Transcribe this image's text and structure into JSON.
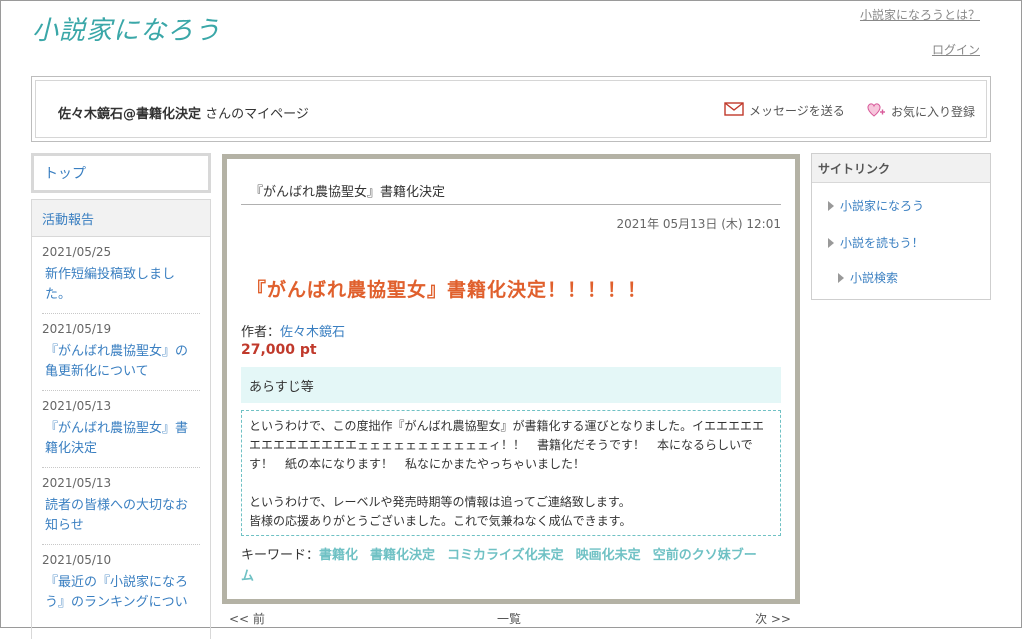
{
  "header": {
    "logo": "小説家になろう",
    "about_link": "小説家になろうとは？",
    "login_link": "ログイン"
  },
  "mypage": {
    "user_name": "佐々木鏡石@書籍化決定",
    "suffix": "さんのマイページ",
    "send_message": "メッセージを送る",
    "favorite": "お気に入り登録"
  },
  "left_sidebar": {
    "top_label": "トップ",
    "report_heading": "活動報告",
    "reports": [
      {
        "date": "2021/05/25",
        "title": "新作短編投稿致しました。"
      },
      {
        "date": "2021/05/19",
        "title": "『がんばれ農協聖女』の亀更新化について"
      },
      {
        "date": "2021/05/13",
        "title": "『がんばれ農協聖女』書籍化決定"
      },
      {
        "date": "2021/05/13",
        "title": "読者の皆様への大切なお知らせ"
      },
      {
        "date": "2021/05/10",
        "title": "『最近の『小説家になろう』のランキングについ"
      }
    ]
  },
  "entry": {
    "title": "『がんばれ農協聖女』書籍化決定",
    "date": "2021年 05月13日 (木) 12:01",
    "headline": "『がんばれ農協聖女』書籍化決定！！！！！",
    "author_label": "作者：",
    "author_name": "佐々木鏡石",
    "points": "27,000 pt",
    "summary_heading": "あらすじ等",
    "summary_lines": [
      "というわけで、この度拙作『がんばれ農協聖女』が書籍化する運びとなりました。イエエエエエエエエエエエエエエェェェェェェェェェェェィ！！　書籍化だそうです！　本になるらしいです！　紙の本になります！　私なにかまたやっちゃいました！",
      "",
      "というわけで、レーベルや発売時期等の情報は追ってご連絡致します。",
      "皆様の応援ありがとうございました。これで気兼ねなく成仏できます。"
    ],
    "keywords_label": "キーワード：",
    "keywords": [
      "書籍化",
      "書籍化決定",
      "コミカライズ化未定",
      "映画化未定",
      "空前のクソ妹ブーム"
    ]
  },
  "pager": {
    "prev": "<< 前",
    "list": "一覧",
    "next": "次 >>"
  },
  "right_sidebar": {
    "heading": "サイトリンク",
    "links": [
      "小説家になろう",
      "小説を読もう！",
      "小説検索"
    ]
  },
  "colors": {
    "brand_teal": "#3aa7a8",
    "link_blue": "#3a7fc1",
    "headline_orange": "#e0602d",
    "points_red": "#c0392b",
    "keyword_teal": "#6fc1c4"
  }
}
